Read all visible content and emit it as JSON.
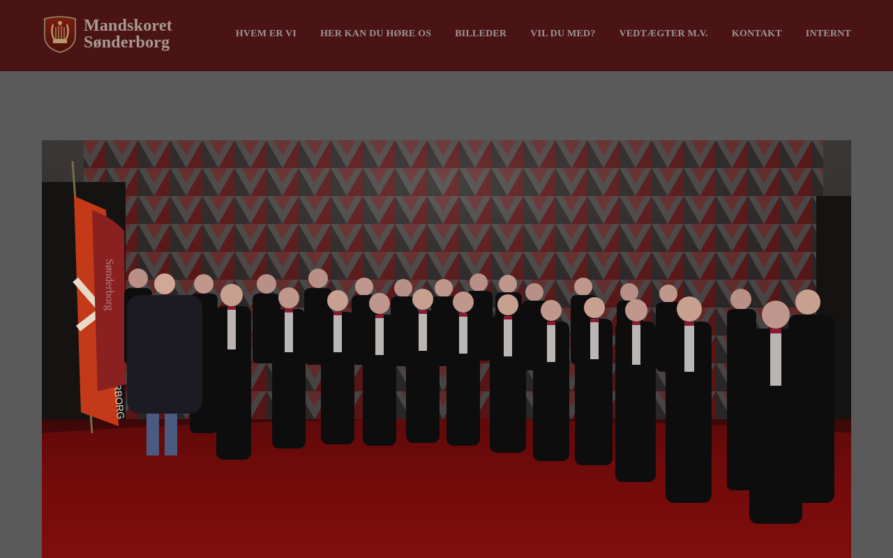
{
  "site": {
    "logo_line1": "Mandskoret",
    "logo_line2": "Sønderborg"
  },
  "nav": {
    "items": [
      "HVEM ER VI",
      "HER KAN DU HØRE OS",
      "BILLEDER",
      "VIL DU MED?",
      "VEDTÆGTER M.V.",
      "KONTAKT",
      "INTERNT"
    ]
  },
  "photo": {
    "flag_text": "SØNDERBORG",
    "banner_text": "Sønderborg"
  },
  "colors": {
    "header_bg": "#4a1414",
    "page_bg": "#5a5a5a",
    "nav_text": "#9a9592",
    "accent_red": "#b01515"
  }
}
